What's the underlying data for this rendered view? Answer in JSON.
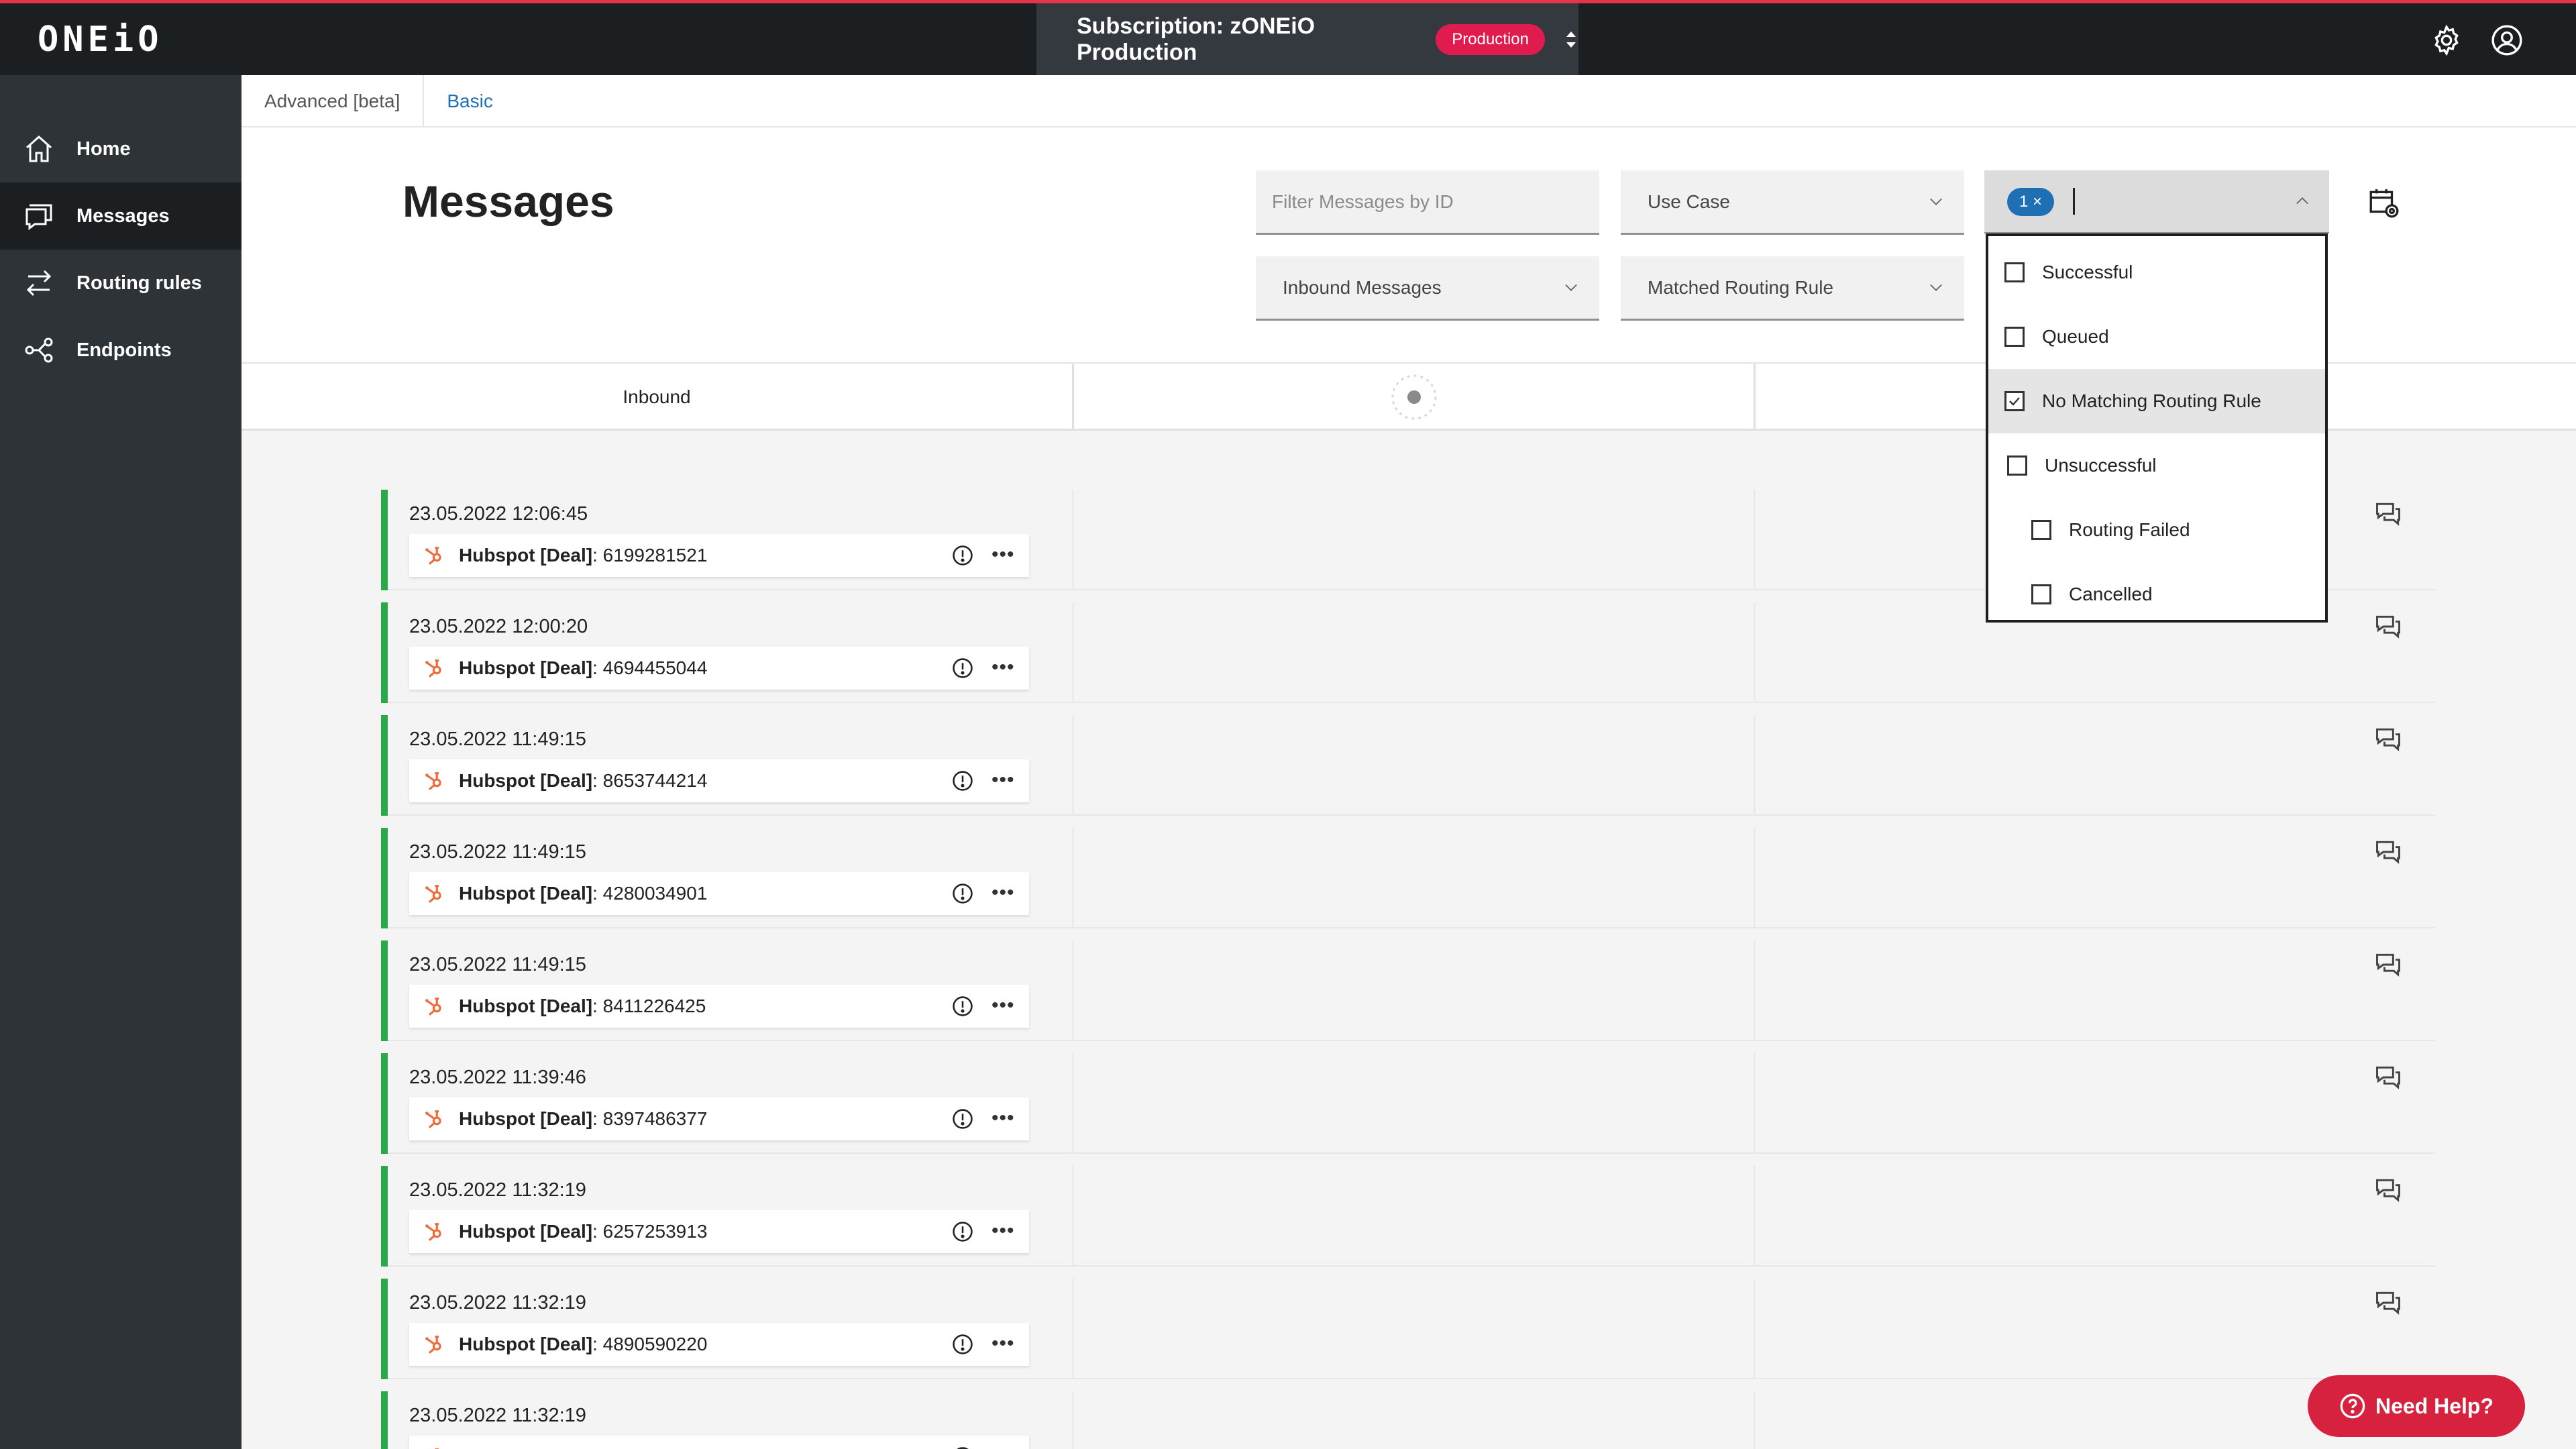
{
  "header": {
    "logo_text": "ONEiO",
    "subscription_title": "Subscription: zONEiO Production",
    "env_badge": "Production",
    "settings_icon": "gear-icon",
    "user_icon": "user-circle-icon"
  },
  "sidebar": {
    "items": [
      {
        "label": "Home",
        "icon": "home-icon"
      },
      {
        "label": "Messages",
        "icon": "messages-icon"
      },
      {
        "label": "Routing rules",
        "icon": "routing-icon"
      },
      {
        "label": "Endpoints",
        "icon": "endpoints-icon"
      }
    ]
  },
  "tabs": [
    "Advanced [beta]",
    "Basic"
  ],
  "main": {
    "title": "Messages",
    "filters": {
      "id_placeholder": "Filter Messages by ID",
      "use_case": "Use Case",
      "direction": "Inbound Messages",
      "routing_rule": "Matched Routing Rule",
      "status_chip": "1 ×"
    },
    "status_options": [
      {
        "label": "Successful",
        "checked": false
      },
      {
        "label": "Queued",
        "checked": false
      },
      {
        "label": "No Matching Routing Rule",
        "checked": true
      },
      {
        "label": "Unsuccessful",
        "checked": false
      },
      {
        "label": "Routing Failed",
        "checked": false
      },
      {
        "label": "Cancelled",
        "checked": false
      }
    ],
    "columns": {
      "inbound": "Inbound"
    },
    "messages": [
      {
        "timestamp": "23.05.2022 12:06:45",
        "source": "Hubspot [Deal]",
        "id": " : 6199281521"
      },
      {
        "timestamp": "23.05.2022 12:00:20",
        "source": "Hubspot [Deal]",
        "id": " : 4694455044"
      },
      {
        "timestamp": "23.05.2022 11:49:15",
        "source": "Hubspot [Deal]",
        "id": " : 8653744214"
      },
      {
        "timestamp": "23.05.2022 11:49:15",
        "source": "Hubspot [Deal]",
        "id": " : 4280034901"
      },
      {
        "timestamp": "23.05.2022 11:49:15",
        "source": "Hubspot [Deal]",
        "id": " : 8411226425"
      },
      {
        "timestamp": "23.05.2022 11:39:46",
        "source": "Hubspot [Deal]",
        "id": " : 8397486377"
      },
      {
        "timestamp": "23.05.2022 11:32:19",
        "source": "Hubspot [Deal]",
        "id": " : 6257253913"
      },
      {
        "timestamp": "23.05.2022 11:32:19",
        "source": "Hubspot [Deal]",
        "id": " : 4890590220"
      },
      {
        "timestamp": "23.05.2022 11:32:19",
        "source": "",
        "id": ""
      }
    ]
  },
  "help_button": "Need Help?",
  "colors": {
    "accent": "#1f6fb5",
    "brand_red": "#e01b4d",
    "success_bar": "#2aa84a",
    "sidebar_bg": "#2e3338"
  }
}
